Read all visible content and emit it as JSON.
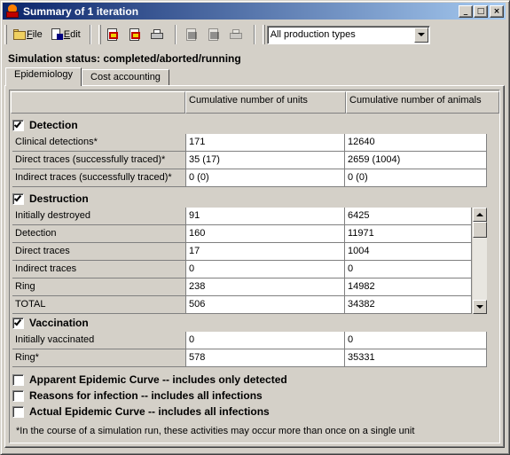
{
  "window": {
    "title": "Summary of 1 iteration"
  },
  "title_buttons": {
    "minimize": "_",
    "maximize": "□",
    "close": "×"
  },
  "toolbar": {
    "file_label": "File",
    "file_mnemonic": "F",
    "edit_label": "dit",
    "edit_mnemonic": "E",
    "production_type_value": "All production types"
  },
  "status": "Simulation status: completed/aborted/running",
  "tabs": [
    {
      "label": "Epidemiology"
    },
    {
      "label": "Cost accounting"
    }
  ],
  "columns": [
    "Cumulative number of units",
    "Cumulative number of animals"
  ],
  "sections": {
    "detection": {
      "title": "Detection",
      "checked": true,
      "rows": [
        {
          "label": "Clinical detections*",
          "units": "171",
          "animals": "12640"
        },
        {
          "label": "Direct traces (successfully traced)*",
          "units": "35 (17)",
          "animals": "2659 (1004)"
        },
        {
          "label": "Indirect traces (successfully traced)*",
          "units": "0 (0)",
          "animals": "0 (0)"
        }
      ]
    },
    "destruction": {
      "title": "Destruction",
      "checked": true,
      "rows": [
        {
          "label": "Initially destroyed",
          "units": "91",
          "animals": "6425"
        },
        {
          "label": "Detection",
          "units": "160",
          "animals": "11971"
        },
        {
          "label": "Direct traces",
          "units": "17",
          "animals": "1004"
        },
        {
          "label": "Indirect traces",
          "units": "0",
          "animals": "0"
        },
        {
          "label": "Ring",
          "units": "238",
          "animals": "14982"
        },
        {
          "label": "TOTAL",
          "units": "506",
          "animals": "34382"
        }
      ]
    },
    "vaccination": {
      "title": "Vaccination",
      "checked": true,
      "rows": [
        {
          "label": "Initially vaccinated",
          "units": "0",
          "animals": "0"
        },
        {
          "label": "Ring*",
          "units": "578",
          "animals": "35331"
        }
      ]
    },
    "apparent_curve": {
      "title": "Apparent Epidemic Curve -- includes only detected",
      "checked": false
    },
    "reasons": {
      "title": "Reasons for infection -- includes all infections",
      "checked": false
    },
    "actual_curve": {
      "title": "Actual Epidemic Curve -- includes all infections",
      "checked": false
    }
  },
  "footnote": "*In the course of a simulation run, these activities may occur more than once on a single unit"
}
